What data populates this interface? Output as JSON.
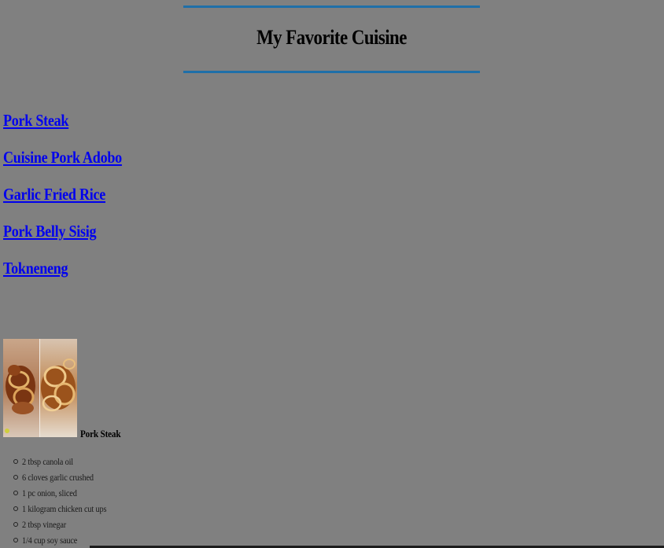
{
  "header": {
    "title": "My Favorite Cuisine"
  },
  "nav": {
    "links": [
      {
        "label": "Pork Steak"
      },
      {
        "label": "Cuisine Pork Adobo"
      },
      {
        "label": "Garlic Fried Rice"
      },
      {
        "label": "Pork Belly Sisig"
      },
      {
        "label": "Tokneneng"
      }
    ]
  },
  "dish": {
    "caption": "Pork Steak",
    "image_icon": "pork-steak-photo",
    "ingredients": [
      "2 tbsp canola oil",
      "6 cloves garlic crushed",
      "1 pc onion, sliced",
      "1 kilogram chicken cut ups",
      "2 tbsp vinegar",
      "1/4 cup soy sauce"
    ]
  },
  "colors": {
    "background": "#808080",
    "title_rule": "#1f6fa8",
    "link": "#0000ee"
  }
}
